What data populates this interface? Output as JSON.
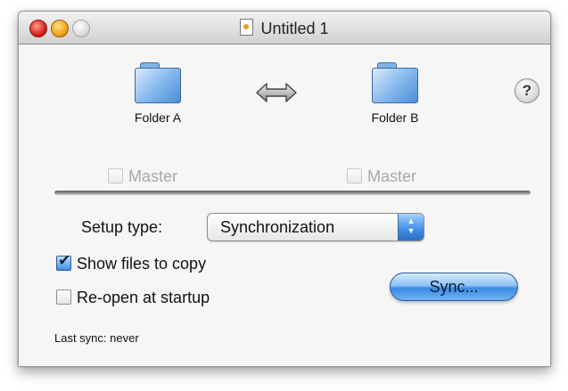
{
  "window": {
    "title": "Untitled 1"
  },
  "folders": {
    "a": {
      "label": "Folder A",
      "icon": "folder-icon"
    },
    "b": {
      "label": "Folder B",
      "icon": "folder-icon"
    },
    "sync_direction_icon": "bidirectional-arrow-icon"
  },
  "help": {
    "label": "?"
  },
  "master": {
    "a_label": "Master",
    "b_label": "Master",
    "a_checked": false,
    "b_checked": false,
    "enabled": false
  },
  "setup": {
    "label": "Setup type:",
    "selected": "Synchronization"
  },
  "options": {
    "show_files": {
      "label": "Show files to copy",
      "checked": true
    },
    "reopen": {
      "label": "Re-open at startup",
      "checked": false
    }
  },
  "sync_button": {
    "label": "Sync..."
  },
  "status": {
    "last_sync": "Last sync: never"
  },
  "colors": {
    "accent": "#3b8ae3",
    "folder": "#8fbef0"
  }
}
